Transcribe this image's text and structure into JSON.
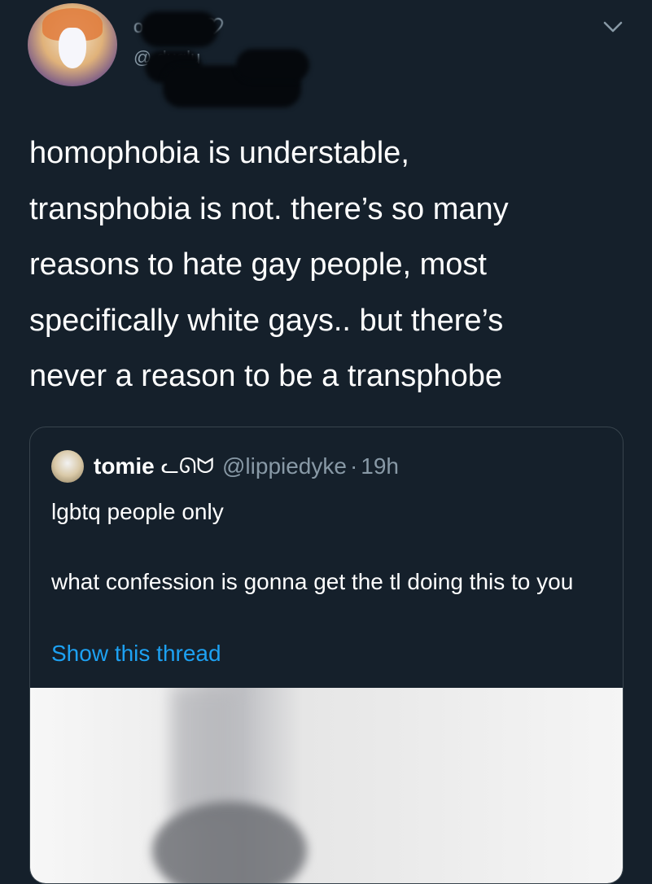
{
  "author": {
    "name_fragment": "o",
    "handle_fragment": "@ duglu"
  },
  "tweet": {
    "text_lines": [
      "homophobia is understable,",
      "transphobia is not. there’s so many",
      "reasons to hate gay people, most",
      "specifically white gays.. but there’s",
      "never a reason to be a transphobe"
    ]
  },
  "quoted": {
    "name": "tomie",
    "name_decoration": "ᓚᘏᗢ",
    "handle": "@lippiedyke",
    "separator": "·",
    "time": "19h",
    "line1": "lgbtq people only",
    "line2": "what confession is gonna get the tl doing this to you",
    "show_thread": "Show this thread"
  },
  "icons": {
    "menu": "chevron-down-icon",
    "heart": "heart-icon"
  },
  "colors": {
    "background": "#15202b",
    "link": "#1da1f2",
    "muted": "#8899a6"
  }
}
